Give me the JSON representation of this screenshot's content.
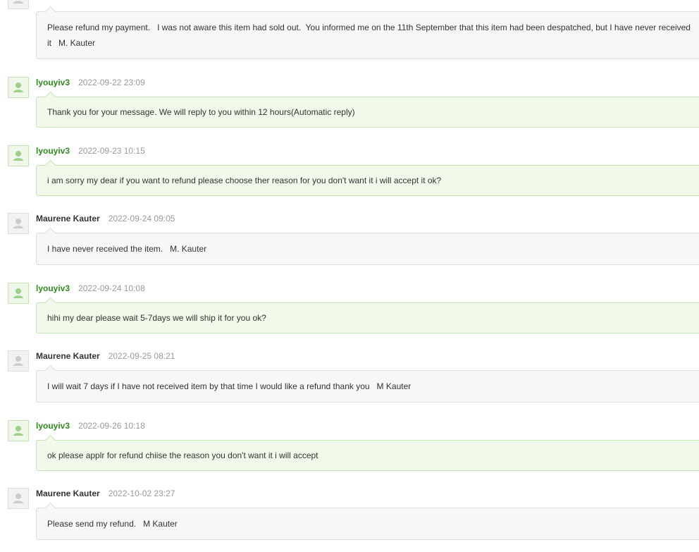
{
  "messages": [
    {
      "role": "buyer",
      "author": "",
      "time": "",
      "text": "Please refund my payment.   I was not aware this item had sold out.  You informed me on the 11th September that this item had been despatched, but I have never received it   M. Kauter"
    },
    {
      "role": "seller",
      "author": "lyouyiv3",
      "time": "2022-09-22 23:09",
      "text": "Thank you for your message. We will reply to you within 12 hours(Automatic reply)"
    },
    {
      "role": "seller",
      "author": "lyouyiv3",
      "time": "2022-09-23 10:15",
      "text": "i am sorry my dear if you want to refund please choose ther reason for you don't want it i will accept it ok?"
    },
    {
      "role": "buyer",
      "author": "Maurene Kauter",
      "time": "2022-09-24 09:05",
      "text": "I have never received the item.   M. Kauter"
    },
    {
      "role": "seller",
      "author": "lyouyiv3",
      "time": "2022-09-24 10:08",
      "text": "hihi my dear please wait 5-7days we will ship it for you ok?"
    },
    {
      "role": "buyer",
      "author": "Maurene Kauter",
      "time": "2022-09-25 08:21",
      "text": "I will wait 7 days if I have not received item by that time I would like a refund thank you   M Kauter"
    },
    {
      "role": "seller",
      "author": "lyouyiv3",
      "time": "2022-09-26 10:18",
      "text": "ok please applr for refund chiise the reason you don't want it i will accept"
    },
    {
      "role": "buyer",
      "author": "Maurene Kauter",
      "time": "2022-10-02 23:27",
      "text": "Please send my refund.   M Kauter"
    }
  ],
  "icons": {
    "avatar": "user-avatar-icon"
  },
  "colors": {
    "seller_name": "#2d8a1d",
    "seller_bubble": "#f1faea",
    "buyer_bubble": "#f7f7f7",
    "timestamp": "#999999"
  }
}
